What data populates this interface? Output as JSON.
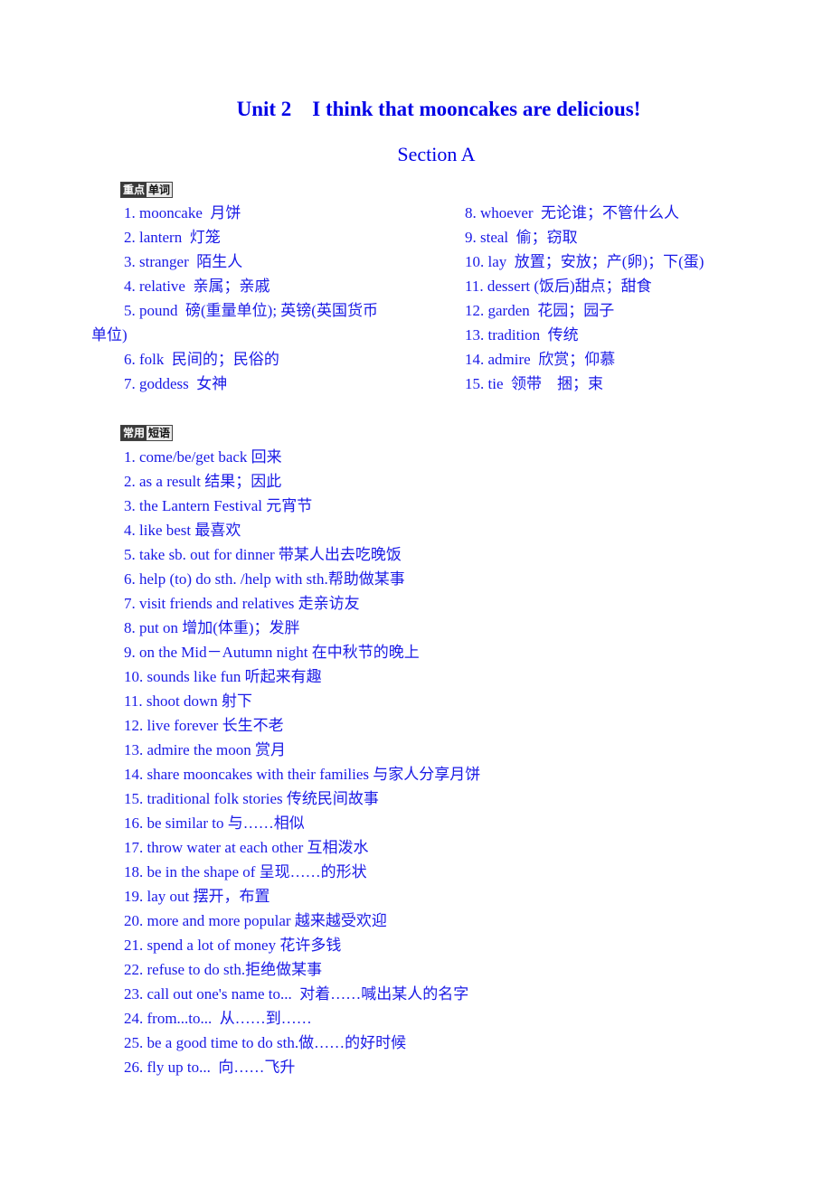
{
  "header": {
    "title": "Unit 2    I think that mooncakes are delicious!",
    "section": "Section A"
  },
  "vocabulary": {
    "badge_dark": "重点",
    "badge_light": "单词",
    "left_items": [
      "1. mooncake  月饼",
      "2. lantern  灯笼",
      "3. stranger  陌生人",
      "4. relative  亲属；亲戚",
      "5. pound  磅(重量单位); 英镑(英国货币",
      "6. folk  民间的；民俗的",
      "7. goddess  女神"
    ],
    "left_wrap": "单位)",
    "right_items": [
      "8. whoever  无论谁；不管什么人",
      "9. steal  偷；窃取",
      "10. lay  放置；安放；产(卵)；下(蛋)",
      "11. dessert (饭后)甜点；甜食",
      "12. garden  花园；园子",
      "13. tradition  传统",
      "14. admire  欣赏；仰慕",
      "15. tie  领带    捆；束"
    ]
  },
  "phrases": {
    "badge_dark": "常用",
    "badge_light": "短语",
    "items": [
      "1. come/be/get back 回来",
      "2. as a result 结果；因此",
      "3. the Lantern Festival 元宵节",
      "4. like best 最喜欢",
      "5. take sb. out for dinner 带某人出去吃晚饭",
      "6. help (to) do sth. /help with sth.帮助做某事",
      "7. visit friends and relatives 走亲访友",
      "8. put on 增加(体重)；发胖",
      "9. on the Mid－Autumn night 在中秋节的晚上",
      "10. sounds like fun 听起来有趣",
      "11. shoot down 射下",
      "12. live forever 长生不老",
      "13. admire the moon 赏月",
      "14. share mooncakes with their families 与家人分享月饼",
      "15. traditional folk stories 传统民间故事",
      "16. be similar to 与……相似",
      "17. throw water at each other 互相泼水",
      "18. be in the shape of 呈现……的形状",
      "19. lay out 摆开，布置",
      "20. more and more popular 越来越受欢迎",
      "21. spend a lot of money 花许多钱",
      "22. refuse to do sth.拒绝做某事",
      "23. call out one's name to...  对着……喊出某人的名字",
      "24. from...to...  从……到……",
      "25. be a good time to do sth.做……的好时候",
      "26. fly up to...  向……飞升"
    ]
  }
}
